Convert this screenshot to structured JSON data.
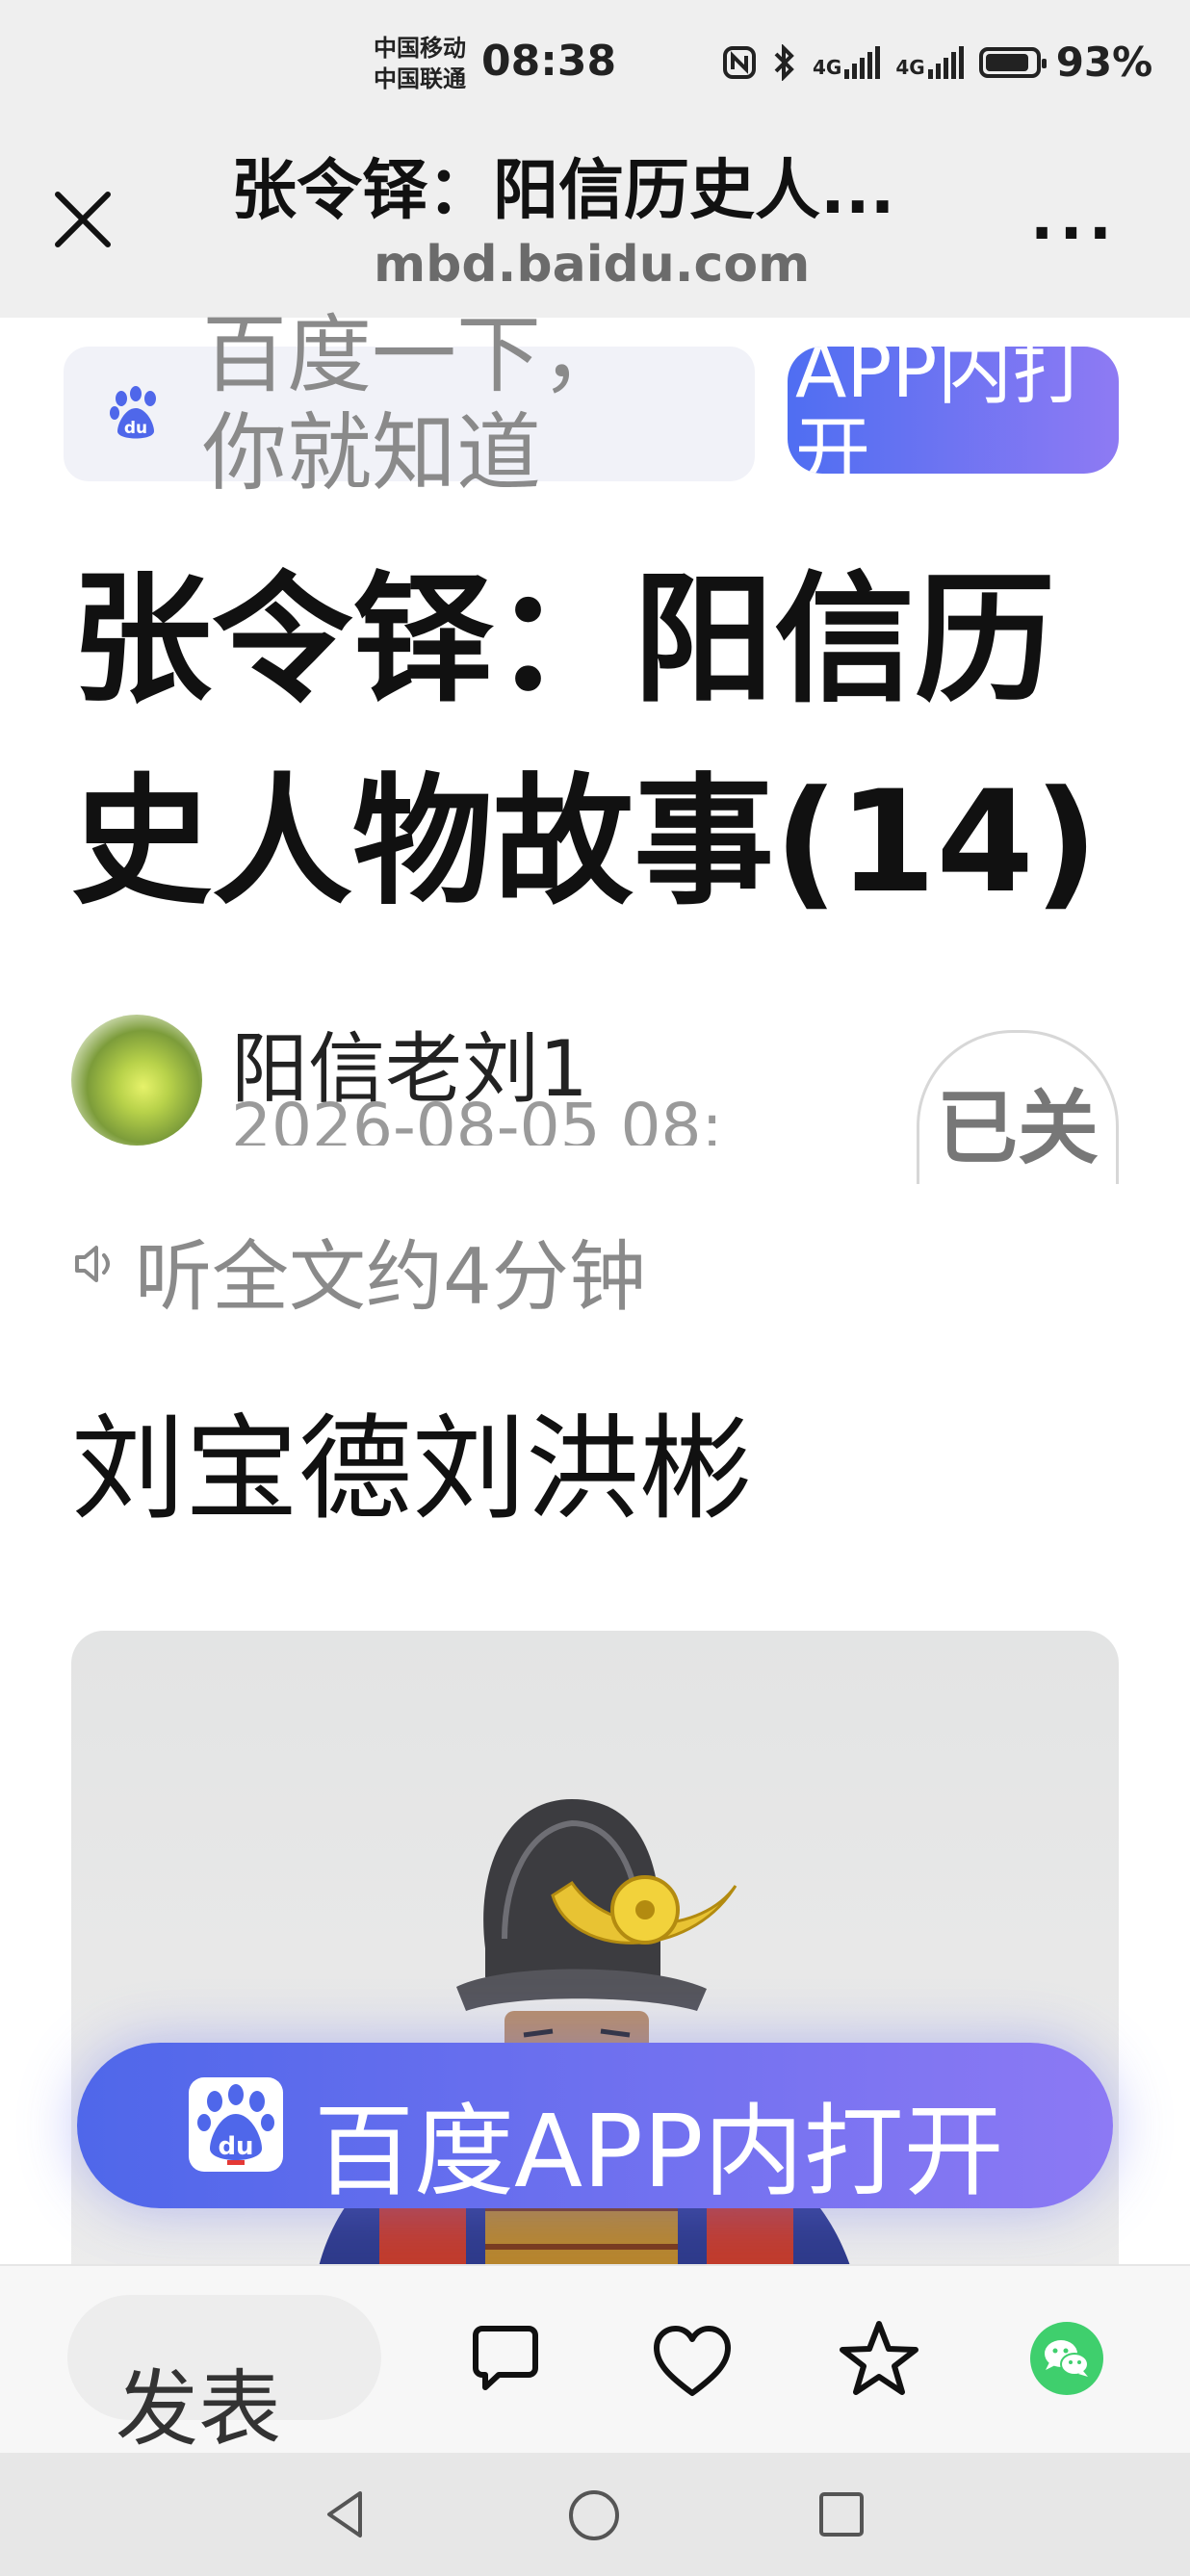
{
  "status_bar": {
    "carrier_1": "中国移动",
    "carrier_2": "中国联通",
    "time": "08:38",
    "network_1": "4G",
    "network_2": "4G",
    "battery": "93%",
    "battery_level": 0.93
  },
  "browser": {
    "page_title": "张令铎：阳信历史人...",
    "url": "mbd.baidu.com",
    "more_label": "..."
  },
  "search": {
    "placeholder": "百度一下，你就知道",
    "open_app_label": "APP内打开"
  },
  "article": {
    "title": "张令铎：阳信历史人物故事(14)",
    "author": "阳信老刘1",
    "date": "2026-08-05 08:",
    "follow_label": "已关",
    "listen_label": "听全文约4分钟",
    "subtitle": "刘宝德刘洪彬"
  },
  "float_button": {
    "label": "百度APP内打开",
    "logo_text": "du"
  },
  "bottom_bar": {
    "comment_label": "发表",
    "icons": [
      "comment-icon",
      "like-icon",
      "favorite-icon",
      "wechat-share-icon"
    ]
  },
  "colors": {
    "accent_start": "#4f67ea",
    "accent_end": "#8c79f4",
    "wechat": "#3fcf6d"
  }
}
